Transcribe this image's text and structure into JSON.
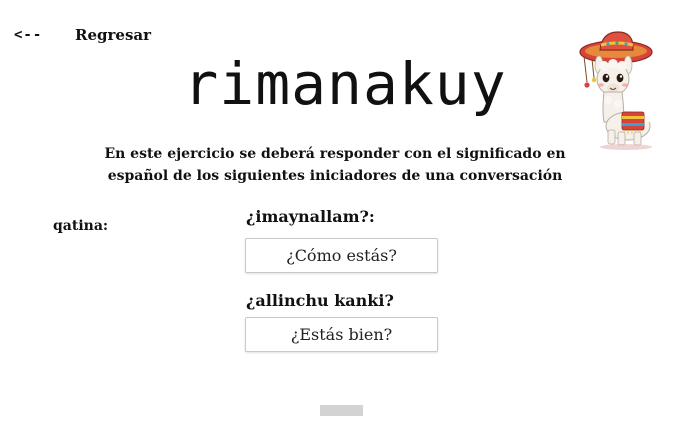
{
  "nav": {
    "back_arrow": "<--",
    "back_label": "Regresar"
  },
  "app": {
    "title": "rimanakuy"
  },
  "mascot": {
    "icon": "llama-sombrero-icon"
  },
  "exercise": {
    "instructions": "En este ejercicio se deberá responder con el significado en español de los siguientes iniciadores de una conversación",
    "speaker_label": "qatina:",
    "items": [
      {
        "prompt": "¿imaynallam?:",
        "answer": "¿Cómo estás?"
      },
      {
        "prompt": "¿allinchu kanki?",
        "answer": "¿Estás bien?"
      }
    ]
  },
  "colors": {
    "accent_red": "#d9443a",
    "accent_yellow": "#f2c23a",
    "input_border": "#c9c9c9",
    "button_gray": "#d3d3d3"
  }
}
